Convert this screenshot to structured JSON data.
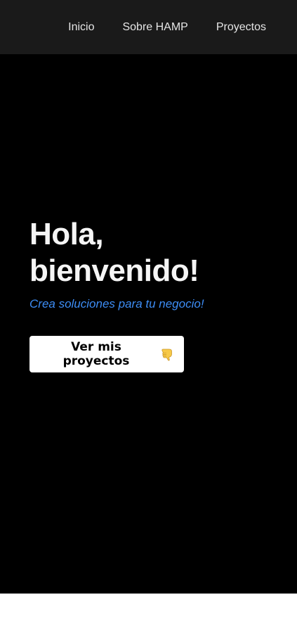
{
  "nav": {
    "items": [
      {
        "label": "Inicio"
      },
      {
        "label": "Sobre HAMP"
      },
      {
        "label": "Proyectos"
      }
    ]
  },
  "hero": {
    "title_line1": "Hola,",
    "title_line2": "bienvenido!",
    "subtitle": "Crea soluciones para tu negocio!",
    "cta_label": "Ver mis proyectos",
    "cta_icon": "pointing-down-hand-icon"
  },
  "colors": {
    "navbar_bg": "#1a1a1a",
    "hero_bg": "#000000",
    "subtitle_accent": "#3d8df5",
    "button_bg": "#ffffff"
  }
}
